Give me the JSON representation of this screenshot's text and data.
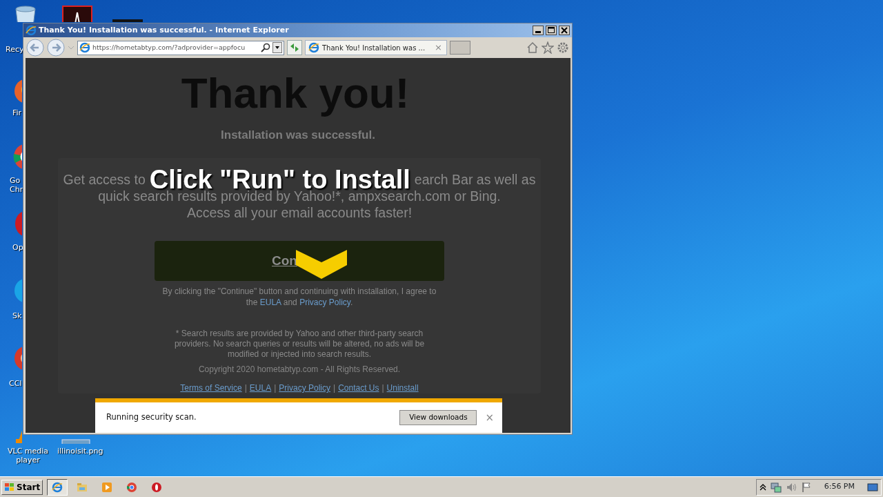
{
  "desktop_icons": [
    {
      "kind": "recycle",
      "lines": [
        "Recy"
      ]
    },
    {
      "kind": "pdf"
    },
    {
      "kind": "app"
    },
    {
      "kind": "firefox",
      "lines": [
        "Fir"
      ]
    },
    {
      "kind": "chrome",
      "lines": [
        "Go",
        "Chr"
      ]
    },
    {
      "kind": "opera",
      "lines": [
        "Op"
      ]
    },
    {
      "kind": "skype",
      "lines": [
        "Sk"
      ]
    },
    {
      "kind": "ccleaner",
      "lines": [
        "CCl"
      ]
    },
    {
      "kind": "vlc",
      "lines": [
        "VLC media",
        "player"
      ]
    },
    {
      "kind": "image",
      "lines": [
        "illinoisit.png"
      ]
    }
  ],
  "window": {
    "title": "Thank You! Installation was successful. - Internet Explorer",
    "address": "https://hometabtyp.com/?adprovider=appfocu",
    "tab": {
      "title": "Thank You! Installation was ...",
      "close": "×",
      "selected": true
    }
  },
  "page": {
    "heading": "Thank you!",
    "subheading": "Installation was successful.",
    "overlay_heading": "Click \"Run\" to Install",
    "intro_line_1": [
      "Get access to",
      "earch Bar as well as"
    ],
    "intro_lines": [
      "quick search results provided by Yahoo!*, ampxsearch.com or Bing.",
      "Access all your email accounts faster!"
    ],
    "button": "Con",
    "consent": [
      {
        "kind": "text",
        "text": "By clicking the \"Continue\" button and continuing with installation, I agree to the "
      },
      {
        "kind": "link",
        "text": "EULA"
      },
      {
        "kind": "text",
        "text": " and "
      },
      {
        "kind": "link",
        "text": "Privacy Policy"
      },
      {
        "kind": "text",
        "text": "."
      }
    ],
    "footnote": "* Search results are provided by Yahoo and other third-party search providers. No search queries or results will be altered, no ads will be modified or injected into search results.",
    "copyright": "Copyright 2020 hometabtyp.com - All Rights Reserved.",
    "footer": [
      {
        "kind": "link",
        "text": "Terms of Service"
      },
      {
        "kind": "separator",
        "text": "|"
      },
      {
        "kind": "link",
        "text": "EULA"
      },
      {
        "kind": "separator",
        "text": "|"
      },
      {
        "kind": "link",
        "text": "Privacy Policy"
      },
      {
        "kind": "separator",
        "text": "|"
      },
      {
        "kind": "link",
        "text": "Contact Us"
      },
      {
        "kind": "separator",
        "text": "|"
      },
      {
        "kind": "link",
        "text": "Uninstall"
      }
    ]
  },
  "notification": {
    "message": "Running security scan.",
    "button": "View downloads",
    "close": "×"
  },
  "taskbar": {
    "start": "Start",
    "apps": [
      {
        "kind": "ie",
        "selected": true
      },
      {
        "kind": "explorer",
        "selected": false
      },
      {
        "kind": "media",
        "selected": false
      },
      {
        "kind": "chrome",
        "selected": false
      },
      {
        "kind": "opera",
        "selected": false
      }
    ],
    "time": "6:56 PM"
  }
}
